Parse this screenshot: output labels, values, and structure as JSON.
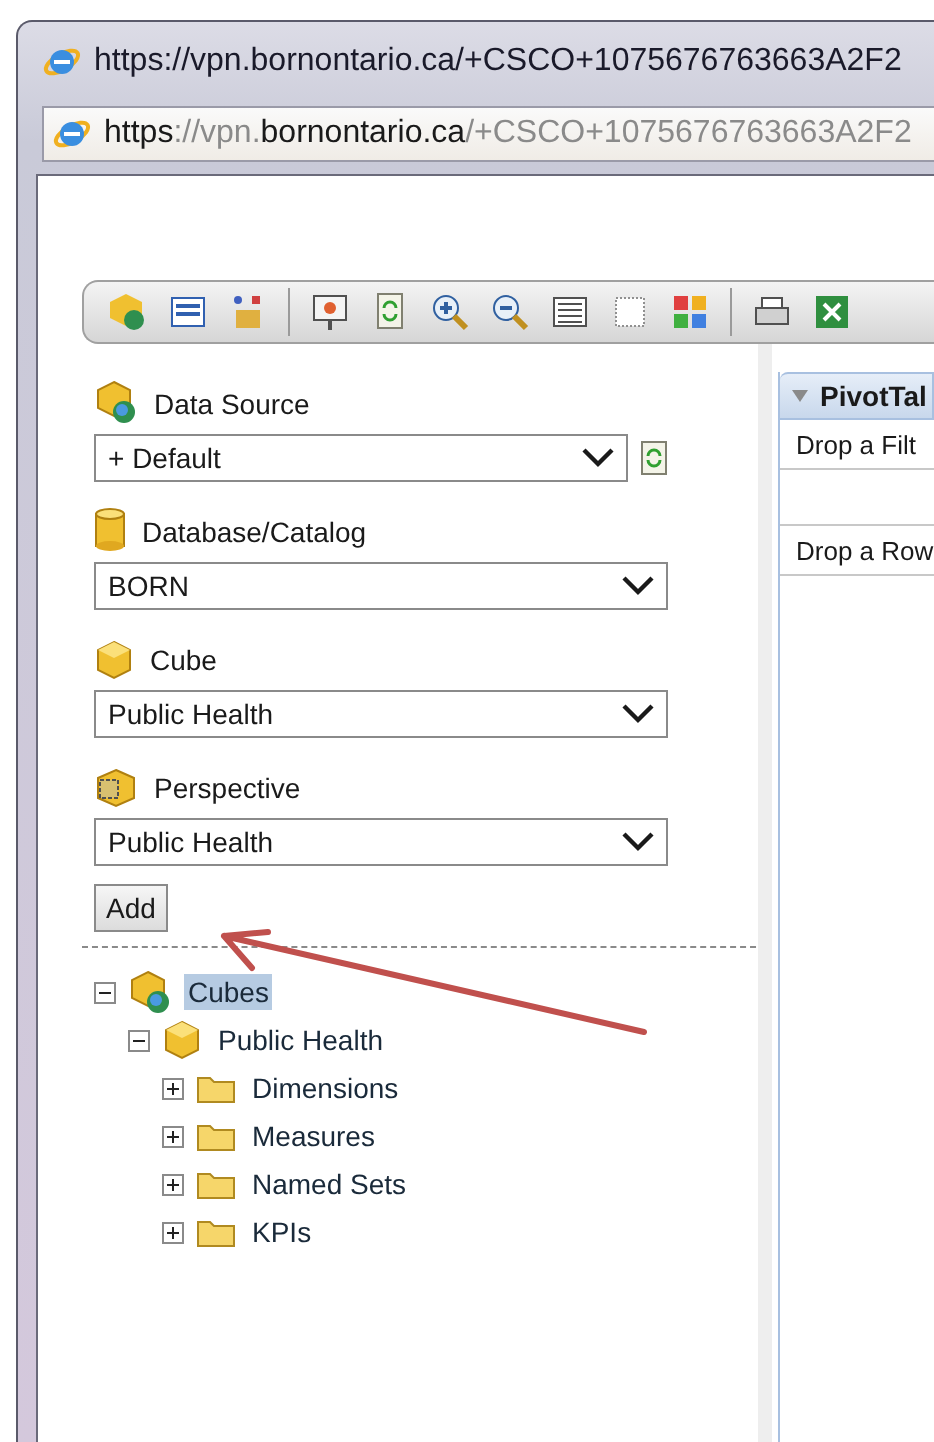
{
  "window": {
    "title": "https://vpn.bornontario.ca/+CSCO+1075676763663A2F2"
  },
  "address_bar": {
    "segments": [
      {
        "text": "https",
        "strong": true
      },
      {
        "text": "://vpn.",
        "strong": false
      },
      {
        "text": "bornontario.ca",
        "strong": true
      },
      {
        "text": "/+CSCO+1075676763663A2F2",
        "strong": false
      }
    ]
  },
  "source_panel": {
    "fields": [
      {
        "kind": "datasource",
        "label": "Data Source",
        "value": "+ Default",
        "refresh": true
      },
      {
        "kind": "database",
        "label": "Database/Catalog",
        "value": "BORN",
        "refresh": false
      },
      {
        "kind": "cube",
        "label": "Cube",
        "value": "Public Health",
        "refresh": false
      },
      {
        "kind": "perspective",
        "label": "Perspective",
        "value": "Public Health",
        "refresh": false
      }
    ],
    "add_button": "Add"
  },
  "tree": [
    {
      "kind": "cubes",
      "label": "Cubes",
      "selected": true,
      "expanded": true,
      "children": [
        {
          "kind": "cube",
          "label": "Public Health",
          "selected": false,
          "expanded": true,
          "children": [
            {
              "kind": "folder",
              "label": "Dimensions",
              "selected": false,
              "expanded": false
            },
            {
              "kind": "folder",
              "label": "Measures",
              "selected": false,
              "expanded": false
            },
            {
              "kind": "folder",
              "label": "Named Sets",
              "selected": false,
              "expanded": false
            },
            {
              "kind": "folder",
              "label": "KPIs",
              "selected": false,
              "expanded": false
            }
          ]
        }
      ]
    }
  ],
  "pivot": {
    "title": "PivotTal",
    "filter_zone": "Drop a Filt",
    "row_zone": "Drop a Row"
  }
}
